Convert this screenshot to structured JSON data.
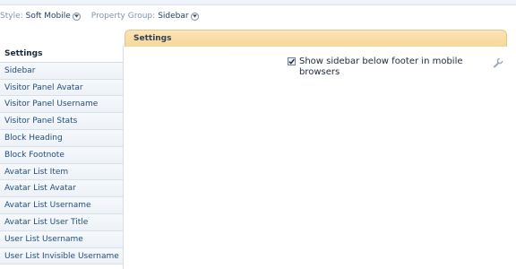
{
  "filters": {
    "style_label": "Style:",
    "style_value": "Soft Mobile",
    "group_label": "Property Group:",
    "group_value": "Sidebar"
  },
  "sidebar": {
    "items": [
      {
        "label": "Settings"
      },
      {
        "label": "Sidebar"
      },
      {
        "label": "Visitor Panel Avatar"
      },
      {
        "label": "Visitor Panel Username"
      },
      {
        "label": "Visitor Panel Stats"
      },
      {
        "label": "Block Heading"
      },
      {
        "label": "Block Footnote"
      },
      {
        "label": "Avatar List Item"
      },
      {
        "label": "Avatar List Avatar"
      },
      {
        "label": "Avatar List Username"
      },
      {
        "label": "Avatar List User Title"
      },
      {
        "label": "User List Username"
      },
      {
        "label": "User List Invisible Username"
      }
    ],
    "active_index": 0
  },
  "panel": {
    "header": "Settings",
    "option": {
      "label": "Show sidebar below footer in mobile browsers",
      "checked": true
    },
    "edit_icon": "wrench-icon"
  },
  "colors": {
    "header_bg": "#f7d79a",
    "link": "#1e4d7d"
  }
}
